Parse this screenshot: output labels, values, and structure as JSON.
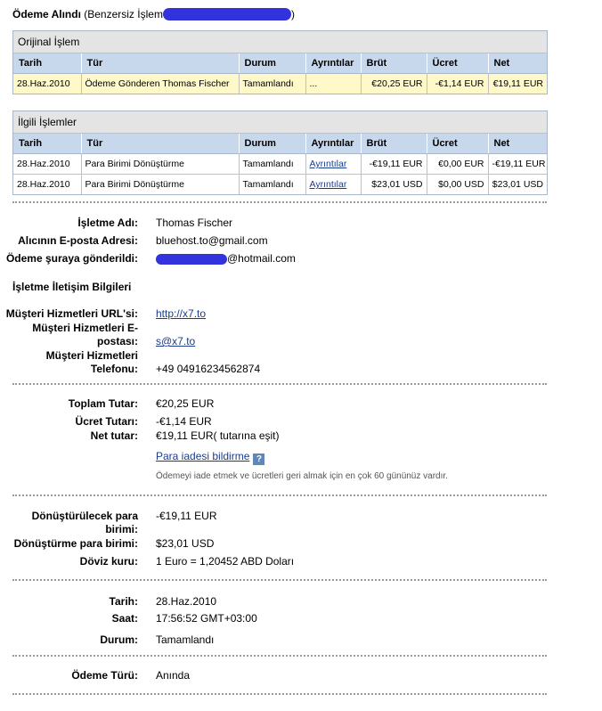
{
  "header": {
    "title_bold": "Ödeme Alındı",
    "title_rest": "(Benzersiz İşlem",
    "title_close": ")"
  },
  "original": {
    "heading": "Orijinal İşlem",
    "columns": [
      "Tarih",
      "Tür",
      "Durum",
      "Ayrıntılar",
      "Brüt",
      "Ücret",
      "Net"
    ],
    "row": {
      "date": "28.Haz.2010",
      "type": "Ödeme Gönderen Thomas Fischer",
      "status": "Tamamlandı",
      "details": "...",
      "gross": "€20,25 EUR",
      "fee": "-€1,14 EUR",
      "net": "€19,11 EUR"
    }
  },
  "related": {
    "heading": "İlgili İşlemler",
    "columns": [
      "Tarih",
      "Tür",
      "Durum",
      "Ayrıntılar",
      "Brüt",
      "Ücret",
      "Net"
    ],
    "rows": [
      {
        "date": "28.Haz.2010",
        "type": "Para Birimi Dönüştürme",
        "status": "Tamamlandı",
        "details": "Ayrıntılar",
        "gross": "-€19,11 EUR",
        "fee": "€0,00 EUR",
        "net": "-€19,11 EUR"
      },
      {
        "date": "28.Haz.2010",
        "type": "Para Birimi Dönüştürme",
        "status": "Tamamlandı",
        "details": "Ayrıntılar",
        "gross": "$23,01 USD",
        "fee": "$0,00 USD",
        "net": "$23,01 USD"
      }
    ]
  },
  "business": {
    "name_label": "İşletme Adı:",
    "name": "Thomas Fischer",
    "recipient_label": "Alıcının E-posta Adresi:",
    "recipient": "bluehost.to@gmail.com",
    "sent_to_label": "Ödeme şuraya gönderildi:",
    "sent_to_suffix": "@hotmail.com"
  },
  "contact": {
    "heading": "İşletme İletişim Bilgileri",
    "url_label": "Müşteri Hizmetleri URL'si:",
    "url": "http://x7.to",
    "email_label": "Müşteri Hizmetleri E-postası:",
    "email": "s@x7.to",
    "phone_label": "Müşteri Hizmetleri Telefonu:",
    "phone": "+49 04916234562874"
  },
  "amounts": {
    "total_label": "Toplam Tutar:",
    "total": "€20,25 EUR",
    "fee_label": "Ücret Tutarı:",
    "fee": "-€1,14 EUR",
    "net_label": "Net tutar:",
    "net": "€19,11 EUR( tutarına eşit)",
    "refund_link": "Para iadesi bildirme",
    "refund_note": "Ödemeyi iade etmek ve ücretleri geri almak için en çok 60 gününüz vardır."
  },
  "conversion": {
    "from_label": "Dönüştürülecek para birimi:",
    "from": "-€19,11 EUR",
    "to_label": "Dönüştürme para birimi:",
    "to": "$23,01 USD",
    "rate_label": "Döviz kuru:",
    "rate": "1 Euro = 1,20452 ABD Doları"
  },
  "timing": {
    "date_label": "Tarih:",
    "date": "28.Haz.2010",
    "time_label": "Saat:",
    "time": "17:56:52 GMT+03:00",
    "status_label": "Durum:",
    "status": "Tamamlandı"
  },
  "payment": {
    "type_label": "Ödeme Türü:",
    "type": "Anında"
  },
  "colors": {
    "redaction": "#3333dd",
    "table_header": "#c8d8ec",
    "highlight_row": "#fff8c8",
    "link": "#1a3c8c"
  }
}
